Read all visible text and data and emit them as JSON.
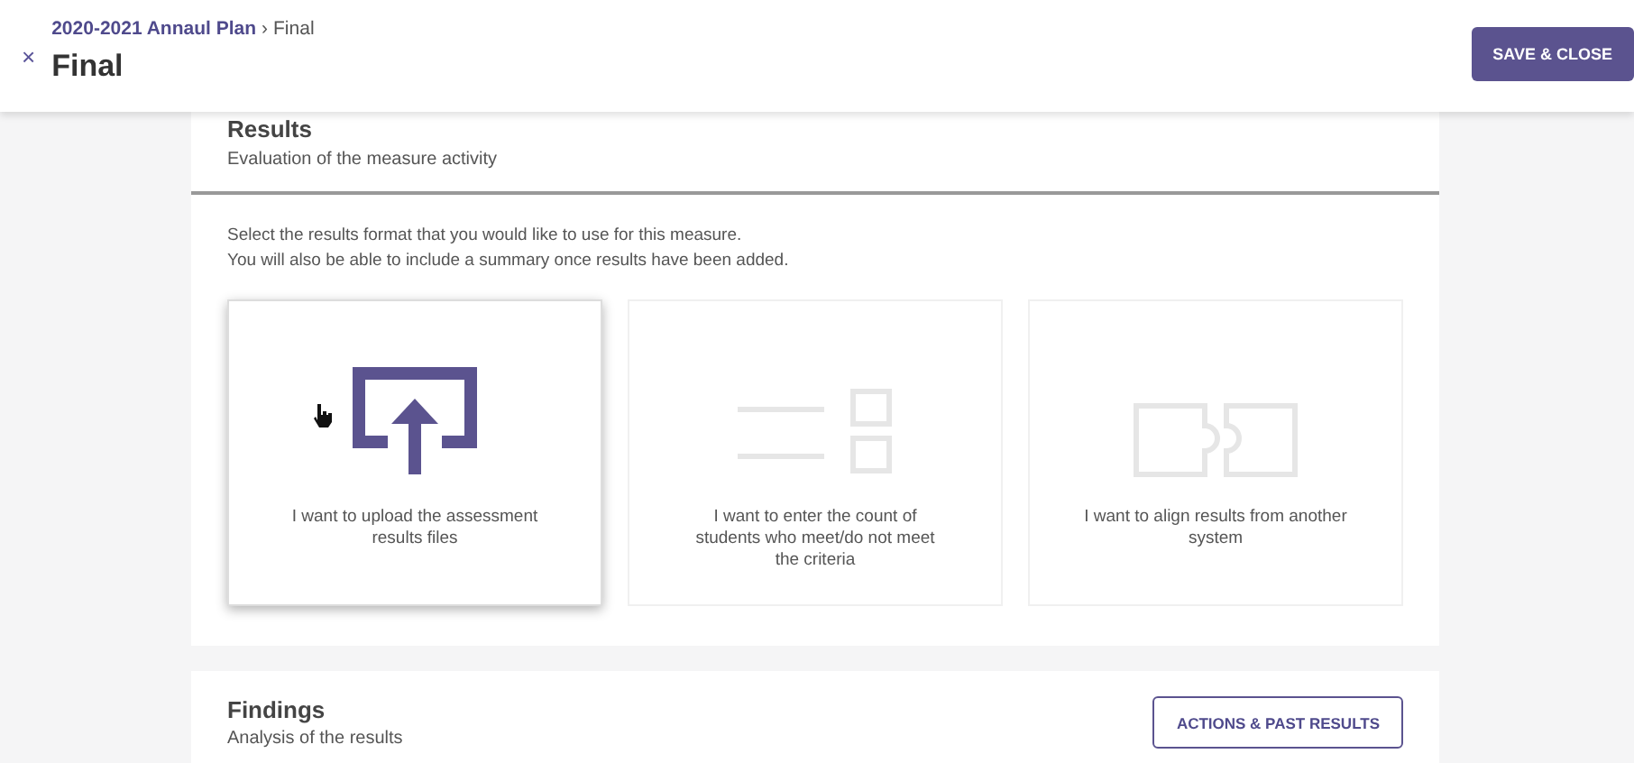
{
  "header": {
    "breadcrumb": {
      "parent": "2020-2021 Annaul Plan",
      "separator": "›",
      "current": "Final"
    },
    "close_glyph": "×",
    "title": "Final",
    "save_button": "SAVE & CLOSE"
  },
  "results": {
    "title": "Results",
    "subtitle": "Evaluation of the measure activity",
    "instructions": [
      "Select the results format that you would like to use for this measure.",
      "You will also be able to include a summary once results have been added."
    ],
    "options": [
      {
        "kind": "upload",
        "label": "I want to upload the assessment results files",
        "selected": true
      },
      {
        "kind": "count",
        "label": "I want to enter the count of students who meet/do not meet the criteria",
        "selected": false
      },
      {
        "kind": "align",
        "label": "I want to align results from another system",
        "selected": false
      }
    ]
  },
  "findings": {
    "title": "Findings",
    "subtitle": "Analysis of the results",
    "button": "ACTIONS & PAST RESULTS"
  }
}
